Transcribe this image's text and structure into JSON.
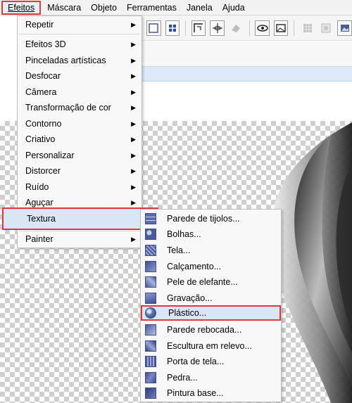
{
  "menubar": {
    "items": [
      {
        "label": "Efeitos",
        "active": true
      },
      {
        "label": "Máscara"
      },
      {
        "label": "Objeto"
      },
      {
        "label": "Ferramentas"
      },
      {
        "label": "Janela"
      },
      {
        "label": "Ajuda"
      }
    ]
  },
  "toolbar": {
    "icons": [
      "crop-frame-icon",
      "move-target-icon",
      "corner-tool-icon",
      "eye-crosshair-icon",
      "eraser-icon",
      "eye-view-icon",
      "image-tool-icon",
      "grid-icon",
      "gear-icon",
      "picture-icon"
    ]
  },
  "effects_menu": {
    "items": [
      {
        "label": "Repetir",
        "submenu": true
      },
      {
        "label": "Efeitos 3D",
        "submenu": true
      },
      {
        "label": "Pinceladas artísticas",
        "submenu": true
      },
      {
        "label": "Desfocar",
        "submenu": true
      },
      {
        "label": "Câmera",
        "submenu": true
      },
      {
        "label": "Transformação de cor",
        "submenu": true
      },
      {
        "label": "Contorno",
        "submenu": true
      },
      {
        "label": "Criativo",
        "submenu": true
      },
      {
        "label": "Personalizar",
        "submenu": true
      },
      {
        "label": "Distorcer",
        "submenu": true
      },
      {
        "label": "Ruído",
        "submenu": true
      },
      {
        "label": "Aguçar",
        "submenu": true
      },
      {
        "label": "Textura",
        "submenu": true,
        "highlighted": true
      },
      {
        "label": "Painter",
        "submenu": true
      }
    ]
  },
  "texture_submenu": {
    "items": [
      {
        "label": "Parede de tijolos...",
        "icon": "brick-wall-icon"
      },
      {
        "label": "Bolhas...",
        "icon": "bubbles-icon"
      },
      {
        "label": "Tela...",
        "icon": "canvas-icon"
      },
      {
        "label": "Calçamento...",
        "icon": "pavement-icon"
      },
      {
        "label": "Pele de elefante...",
        "icon": "elephant-skin-icon"
      },
      {
        "label": "Gravação...",
        "icon": "etching-icon"
      },
      {
        "label": "Plástico...",
        "icon": "plastic-icon",
        "highlighted": true
      },
      {
        "label": "Parede rebocada...",
        "icon": "plastered-wall-icon"
      },
      {
        "label": "Escultura em relevo...",
        "icon": "relief-sculpture-icon"
      },
      {
        "label": "Porta de tela...",
        "icon": "screen-door-icon"
      },
      {
        "label": "Pedra...",
        "icon": "stone-icon"
      },
      {
        "label": "Pintura base...",
        "icon": "base-paint-icon"
      }
    ]
  },
  "colors": {
    "highlight_border": "#e0393b",
    "highlight_fill": "#d9e6f6",
    "icon_blue": "#3d4e8a"
  }
}
